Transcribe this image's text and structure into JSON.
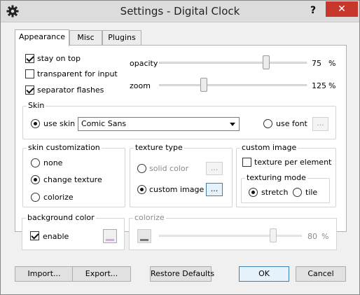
{
  "window": {
    "title": "Settings - Digital Clock",
    "help_label": "?",
    "close_label": "✕"
  },
  "tabs": [
    {
      "label": "Appearance",
      "active": true
    },
    {
      "label": "Misc",
      "active": false
    },
    {
      "label": "Plugins",
      "active": false
    }
  ],
  "general": {
    "stay_on_top": {
      "label": "stay on top",
      "checked": true
    },
    "transparent_input": {
      "label": "transparent for input",
      "checked": false
    },
    "separator_flashes": {
      "label": "separator flashes",
      "checked": true
    },
    "opacity": {
      "label": "opacity",
      "value": "75",
      "unit": "%",
      "level": 0.75
    },
    "zoom": {
      "label": "zoom",
      "value": "125",
      "unit": "%",
      "level": 0.3
    }
  },
  "skin": {
    "title": "Skin",
    "use_skin_label": "use skin",
    "selected_skin": "Comic Sans",
    "use_font_label": "use font",
    "font_button_label": "..."
  },
  "skin_customization": {
    "title": "skin customization",
    "options": [
      {
        "label": "none",
        "checked": false
      },
      {
        "label": "change texture",
        "checked": true
      },
      {
        "label": "colorize",
        "checked": false
      }
    ]
  },
  "texture_type": {
    "title": "texture type",
    "solid_color_label": "solid color",
    "custom_image_label": "custom image",
    "button_label": "..."
  },
  "custom_image": {
    "title": "custom image",
    "texture_per_element_label": "texture per element",
    "texturing_mode_title": "texturing mode",
    "stretch_label": "stretch",
    "tile_label": "tile"
  },
  "background_color": {
    "title": "background color",
    "enable_label": "enable",
    "swatch_color": "#d9a6e8"
  },
  "colorize": {
    "title": "colorize",
    "value": "80",
    "unit": "%",
    "level": 0.8
  },
  "footer": {
    "import_label": "Import...",
    "export_label": "Export...",
    "restore_label": "Restore Defaults",
    "ok_label": "OK",
    "cancel_label": "Cancel"
  }
}
